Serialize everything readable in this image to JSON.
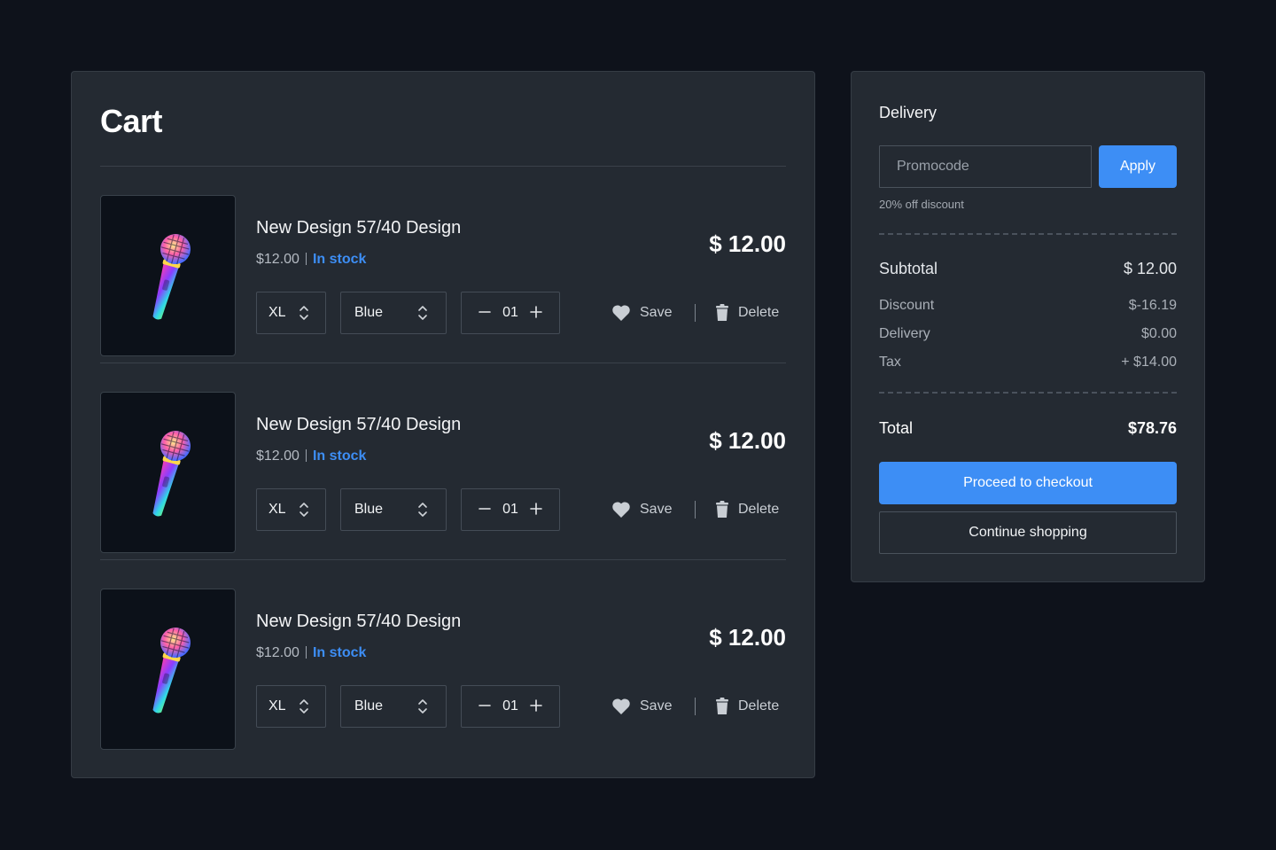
{
  "cart": {
    "title": "Cart",
    "items": [
      {
        "name": "New Design 57/40 Design",
        "unit_price": "$12.00",
        "stock": "In stock",
        "price": "$ 12.00",
        "size": "XL",
        "color": "Blue",
        "qty": "01",
        "save_label": "Save",
        "delete_label": "Delete",
        "image_icon": "microphone-icon"
      },
      {
        "name": "New Design 57/40 Design",
        "unit_price": "$12.00",
        "stock": "In stock",
        "price": "$ 12.00",
        "size": "XL",
        "color": "Blue",
        "qty": "01",
        "save_label": "Save",
        "delete_label": "Delete",
        "image_icon": "microphone-icon"
      },
      {
        "name": "New Design 57/40 Design",
        "unit_price": "$12.00",
        "stock": "In stock",
        "price": "$ 12.00",
        "size": "XL",
        "color": "Blue",
        "qty": "01",
        "save_label": "Save",
        "delete_label": "Delete",
        "image_icon": "microphone-icon"
      }
    ]
  },
  "summary": {
    "title": "Delivery",
    "promo_placeholder": "Promocode",
    "apply_label": "Apply",
    "promo_hint": "20% off discount",
    "subtotal_label": "Subtotal",
    "subtotal_value": "$ 12.00",
    "lines": [
      {
        "label": "Discount",
        "value": "$-16.19"
      },
      {
        "label": "Delivery",
        "value": "$0.00"
      },
      {
        "label": "Tax",
        "value": "+ $14.00"
      }
    ],
    "total_label": "Total",
    "total_value": "$78.76",
    "checkout_label": "Proceed to checkout",
    "continue_label": "Continue shopping"
  },
  "colors": {
    "background": "#0e121b",
    "panel": "#242a32",
    "accent": "#3d8ef5",
    "stock": "#3d8ef5"
  }
}
